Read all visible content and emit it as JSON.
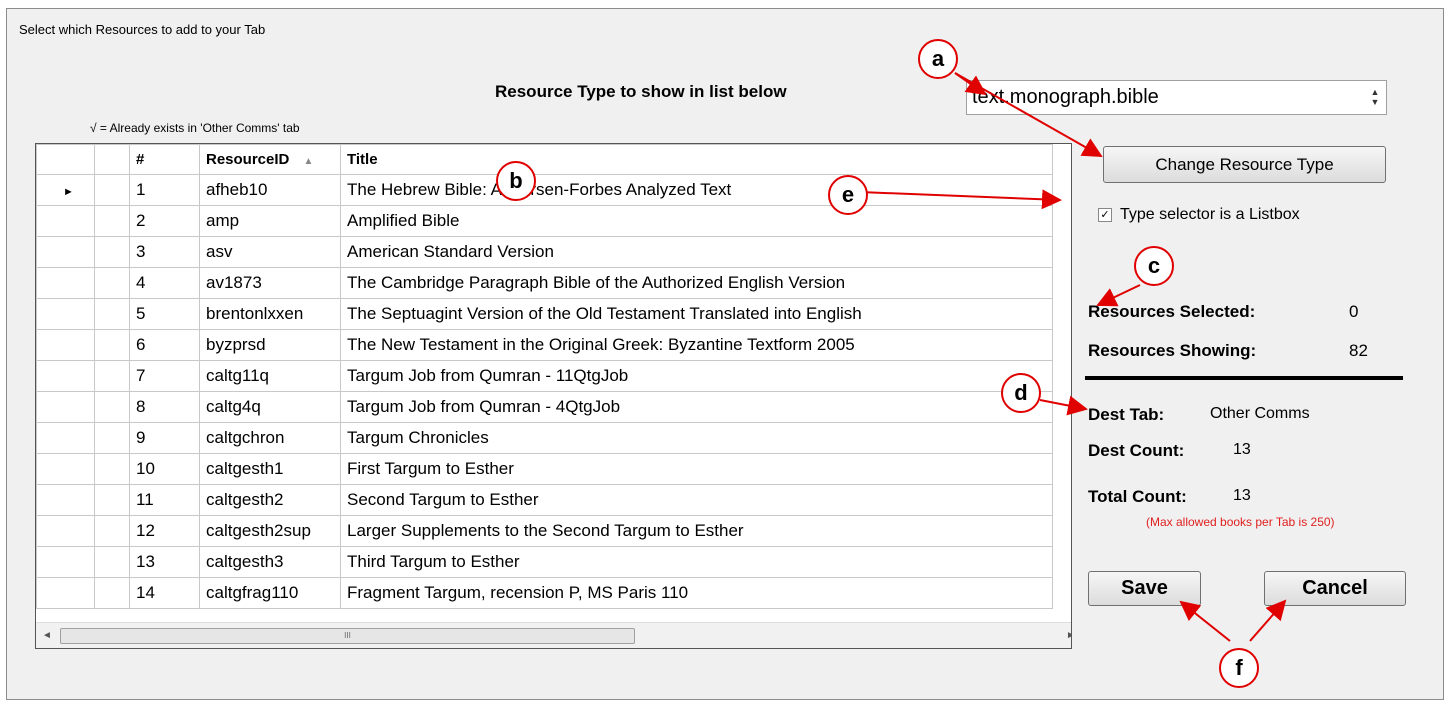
{
  "window": {
    "title": "Select which Resources to add to your Tab"
  },
  "header": {
    "heading": "Resource Type to show in list below",
    "note": "√ = Already exists in 'Other Comms' tab",
    "type_value": "text.monograph.bible"
  },
  "grid": {
    "columns": [
      "#",
      "ResourceID",
      "Title"
    ],
    "rows": [
      {
        "n": "1",
        "id": "afheb10",
        "title": "The Hebrew Bible: Andersen-Forbes Analyzed Text"
      },
      {
        "n": "2",
        "id": "amp",
        "title": "Amplified Bible"
      },
      {
        "n": "3",
        "id": "asv",
        "title": "American Standard Version"
      },
      {
        "n": "4",
        "id": "av1873",
        "title": "The Cambridge Paragraph Bible of the Authorized English Version"
      },
      {
        "n": "5",
        "id": "brentonlxxen",
        "title": "The Septuagint Version of the Old Testament Translated into English"
      },
      {
        "n": "6",
        "id": "byzprsd",
        "title": "The New Testament in the Original Greek: Byzantine Textform 2005"
      },
      {
        "n": "7",
        "id": "caltg11q",
        "title": "Targum Job from Qumran - 11QtgJob"
      },
      {
        "n": "8",
        "id": "caltg4q",
        "title": "Targum Job from Qumran - 4QtgJob"
      },
      {
        "n": "9",
        "id": "caltgchron",
        "title": "Targum Chronicles"
      },
      {
        "n": "10",
        "id": "caltgesth1",
        "title": "First Targum to Esther"
      },
      {
        "n": "11",
        "id": "caltgesth2",
        "title": "Second Targum to Esther"
      },
      {
        "n": "12",
        "id": "caltgesth2sup",
        "title": "Larger Supplements to the Second Targum to Esther"
      },
      {
        "n": "13",
        "id": "caltgesth3",
        "title": "Third Targum to Esther"
      },
      {
        "n": "14",
        "id": "caltgfrag110",
        "title": "Fragment Targum, recension P, MS Paris 110"
      }
    ]
  },
  "side": {
    "change_button": "Change Resource Type",
    "listbox_checkbox": "Type selector is a Listbox",
    "resources_selected_label": "Resources Selected:",
    "resources_selected_value": "0",
    "resources_showing_label": "Resources Showing:",
    "resources_showing_value": "82",
    "dest_tab_label": "Dest Tab:",
    "dest_tab_value": "Other Comms",
    "dest_count_label": "Dest Count:",
    "dest_count_value": "13",
    "total_count_label": "Total Count:",
    "total_count_value": "13",
    "max_note": "(Max allowed books per Tab is 250)",
    "save_button": "Save",
    "cancel_button": "Cancel"
  },
  "callouts": [
    "a",
    "b",
    "c",
    "d",
    "e",
    "f"
  ],
  "colors": {
    "callout_red": "#e00000",
    "warning_red": "#e02020"
  }
}
